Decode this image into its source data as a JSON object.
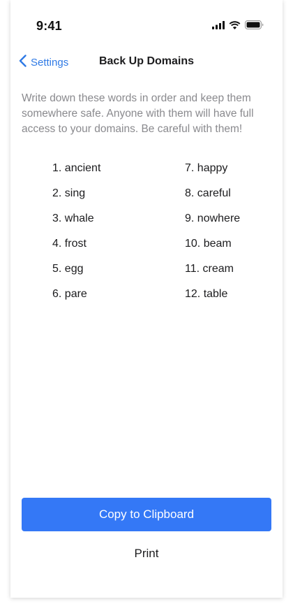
{
  "status_bar": {
    "time": "9:41",
    "icons": [
      "cellular-signal-icon",
      "wifi-icon",
      "battery-icon"
    ]
  },
  "nav": {
    "back_label": "Settings",
    "back_icon": "chevron-left-icon",
    "title": "Back Up Domains"
  },
  "description": "Write down these words in order and keep them somewhere safe. Anyone with them will have full access to your domains. Be careful with them!",
  "words": [
    "1. ancient",
    "2. sing",
    "3. whale",
    "4. frost",
    "5. egg",
    "6. pare",
    "7. happy",
    "8. careful",
    "9. nowhere",
    "10. beam",
    "11. cream",
    "12. table"
  ],
  "actions": {
    "copy_label": "Copy to Clipboard",
    "print_label": "Print"
  },
  "colors": {
    "accent": "#3478f6",
    "link": "#2f7ae5",
    "secondary_text": "#8a8a8e"
  }
}
